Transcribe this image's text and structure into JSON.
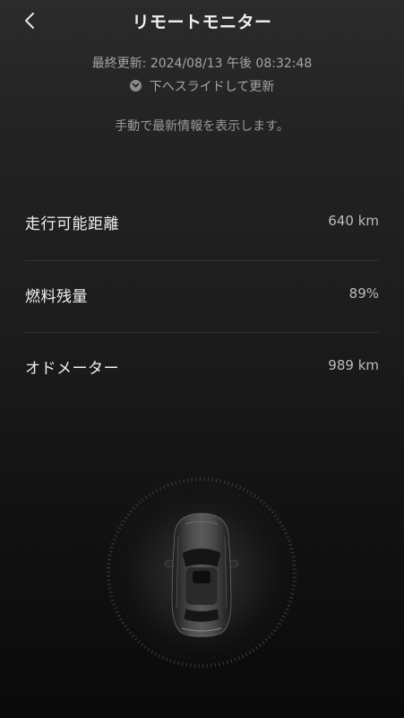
{
  "header": {
    "title": "リモートモニター",
    "back_icon": "chevron-left-icon"
  },
  "status": {
    "last_updated": "最終更新: 2024/08/13 午後 08:32:48",
    "slide_hint": "下へスライドして更新",
    "slide_icon": "chevron-down-circle-icon",
    "manual_note": "手動で最新情報を表示します。"
  },
  "metrics": [
    {
      "label": "走行可能距離",
      "value": "640 km"
    },
    {
      "label": "燃料残量",
      "value": "89%"
    },
    {
      "label": "オドメーター",
      "value": "989 km"
    }
  ],
  "colors": {
    "background_top": "#2b2b2b",
    "background_bottom": "#0a0a0a",
    "primary_text": "#f0f0f0",
    "secondary_text": "#a6a6a6",
    "divider": "#333333"
  }
}
